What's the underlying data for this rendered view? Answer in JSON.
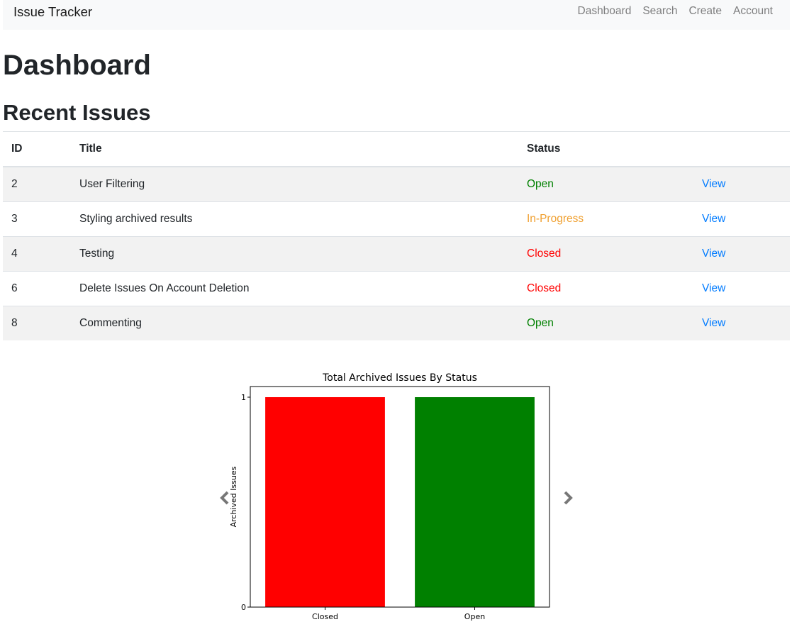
{
  "navbar": {
    "brand": "Issue Tracker",
    "links": [
      "Dashboard",
      "Search",
      "Create",
      "Account"
    ]
  },
  "page": {
    "title": "Dashboard",
    "section_title": "Recent Issues"
  },
  "table": {
    "headers": [
      "ID",
      "Title",
      "Status",
      ""
    ],
    "rows": [
      {
        "id": "2",
        "title": "User Filtering",
        "status": "Open",
        "action": "View"
      },
      {
        "id": "3",
        "title": "Styling archived results",
        "status": "In-Progress",
        "action": "View"
      },
      {
        "id": "4",
        "title": "Testing",
        "status": "Closed",
        "action": "View"
      },
      {
        "id": "6",
        "title": "Delete Issues On Account Deletion",
        "status": "Closed",
        "action": "View"
      },
      {
        "id": "8",
        "title": "Commenting",
        "status": "Open",
        "action": "View"
      }
    ]
  },
  "status_colors": {
    "Open": "#008000",
    "In-Progress": "#f0a030",
    "Closed": "#ff0000"
  },
  "carousel": {
    "prev_icon": "chevron-left-icon",
    "next_icon": "chevron-right-icon"
  },
  "chart_data": {
    "type": "bar",
    "title": "Total Archived Issues By Status",
    "xlabel": "",
    "ylabel": "Archived Issues",
    "categories": [
      "Closed",
      "Open"
    ],
    "values": [
      1,
      1
    ],
    "colors": [
      "#ff0000",
      "#008000"
    ],
    "ylim": [
      0,
      1
    ],
    "yticks": [
      0,
      1
    ],
    "grid": false
  }
}
